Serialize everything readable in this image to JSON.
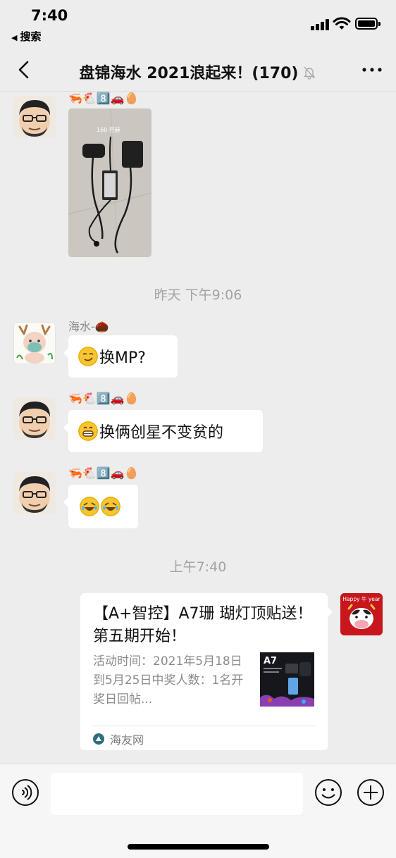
{
  "status_bar": {
    "time": "7:40",
    "back_label": "搜索"
  },
  "nav": {
    "title": "盘锦海水 2021浪起来！(170)",
    "back_icon": "chevron-left-icon",
    "mute_icon": "bell-off-icon",
    "more_icon": "more-dots-icon"
  },
  "messages": [
    {
      "type": "image",
      "sender_avatar": "chubby-avatar",
      "nickname": "🦐🐔8️⃣🚗🥚",
      "photo_text": "160 巴赫"
    },
    {
      "type": "time",
      "text": "昨天 下午9:06"
    },
    {
      "type": "text",
      "sender_avatar": "deer-avatar",
      "nickname": "海水-🌰",
      "emoji": "smirk-emoji",
      "text": "换MP?"
    },
    {
      "type": "text",
      "sender_avatar": "chubby-avatar",
      "nickname": "🦐🐔8️⃣🚗🥚",
      "emoji": "grin-emoji",
      "text": "换俩创星不变贫的"
    },
    {
      "type": "emoji",
      "sender_avatar": "chubby-avatar",
      "nickname": "🦐🐔8️⃣🚗🥚",
      "emojis": [
        "rofl-emoji",
        "rofl-emoji"
      ]
    },
    {
      "type": "time",
      "text": "上午7:40"
    },
    {
      "type": "link_card",
      "sender_avatar": "happy-niu-year-avatar",
      "avatar_text": "Happy 牛 year",
      "title": "【A+智控】A7珊 瑚灯顶贴送！第五期开始！",
      "description": "活动时间：2021年5月18日到5月25日中奖人数：1名开奖日回帖...",
      "thumb_text": "A7",
      "source": "海友网"
    }
  ],
  "input_bar": {
    "voice_icon": "voice-icon",
    "input_value": "",
    "emoji_icon": "emoji-icon",
    "plus_icon": "plus-icon"
  },
  "colors": {
    "chat_bg": "#ededed",
    "bubble_bg": "#ffffff",
    "meta_text": "#a3a3a3"
  }
}
